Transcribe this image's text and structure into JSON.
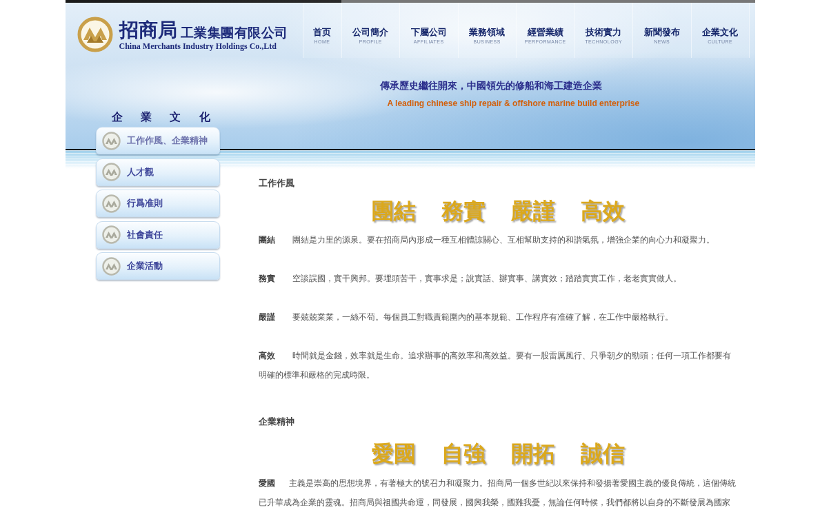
{
  "header": {
    "logo": {
      "name": "招商局",
      "suffix": "工業集團有限公司",
      "english": "China Merchants Industry Holdings Co.,Ltd"
    },
    "nav": [
      {
        "label": "首页",
        "sublabel": "HOME"
      },
      {
        "label": "公司簡介",
        "sublabel": "PROFILE"
      },
      {
        "label": "下屬公司",
        "sublabel": "AFFILIATES"
      },
      {
        "label": "業務領域",
        "sublabel": "BUSINESS"
      },
      {
        "label": "經營業績",
        "sublabel": "PERFORMANCE"
      },
      {
        "label": "技術實力",
        "sublabel": "TECHNOLOGY"
      },
      {
        "label": "新聞發布",
        "sublabel": "NEWS"
      },
      {
        "label": "企業文化",
        "sublabel": "CULTURE"
      }
    ],
    "slogan_zh": "傳承歷史繼往開來，中國領先的修船和海工建造企業",
    "slogan_en": "A leading chinese ship repair & offshore marine build enterprise"
  },
  "sidebar": {
    "title": "企 業 文 化",
    "items": [
      {
        "label": "工作作風、企業精神",
        "selected": true
      },
      {
        "label": "人才觀",
        "selected": false
      },
      {
        "label": "行爲准則",
        "selected": false
      },
      {
        "label": "社會責任",
        "selected": false
      },
      {
        "label": "企業活動",
        "selected": false
      }
    ]
  },
  "content": {
    "sections": [
      {
        "heading": "工作作風",
        "motto": [
          "團結",
          "務實",
          "嚴謹",
          "高效"
        ],
        "entries": [
          {
            "term": "團結",
            "text": "團結是力里的源泉。要在招商局內形成一種互相體諒關心、互相幫助支持的和諧氣氛，增強企業的向心力和凝聚力。"
          },
          {
            "term": "務實",
            "text": "空談誤國，實干興邦。要埋頭苦干，實事求是；說實話、辦實事、講實效；踏踏實實工作，老老實實做人。"
          },
          {
            "term": "嚴謹",
            "text": "要兢兢業業，一絲不苟。每個員工對職責範圍內的基本規範、工作程序有准確了解，在工作中嚴格執行。"
          },
          {
            "term": "高效",
            "text": "時間就是金錢，效率就是生命。追求辦事的高效率和高效益。要有一股雷厲風行、只爭朝夕的勁頭；任何一項工作都要有明確的標準和嚴格的完成時限。"
          }
        ]
      },
      {
        "heading": "企業精神",
        "motto": [
          "愛國",
          "自強",
          "開拓",
          "誠信"
        ],
        "entries": [
          {
            "term": "愛國",
            "text": "主義是崇高的思想境界，有著極大的號召力和凝聚力。招商局一個多世紀以來保持和發揚著愛國主義的優良傳統，這個傳統已升華成為企業的靈魂。招商局與祖國共命運，同發展，國興我榮，國難我憂，無論任何時候，我們都將以自身的不斷發展為國家"
          }
        ]
      }
    ]
  }
}
